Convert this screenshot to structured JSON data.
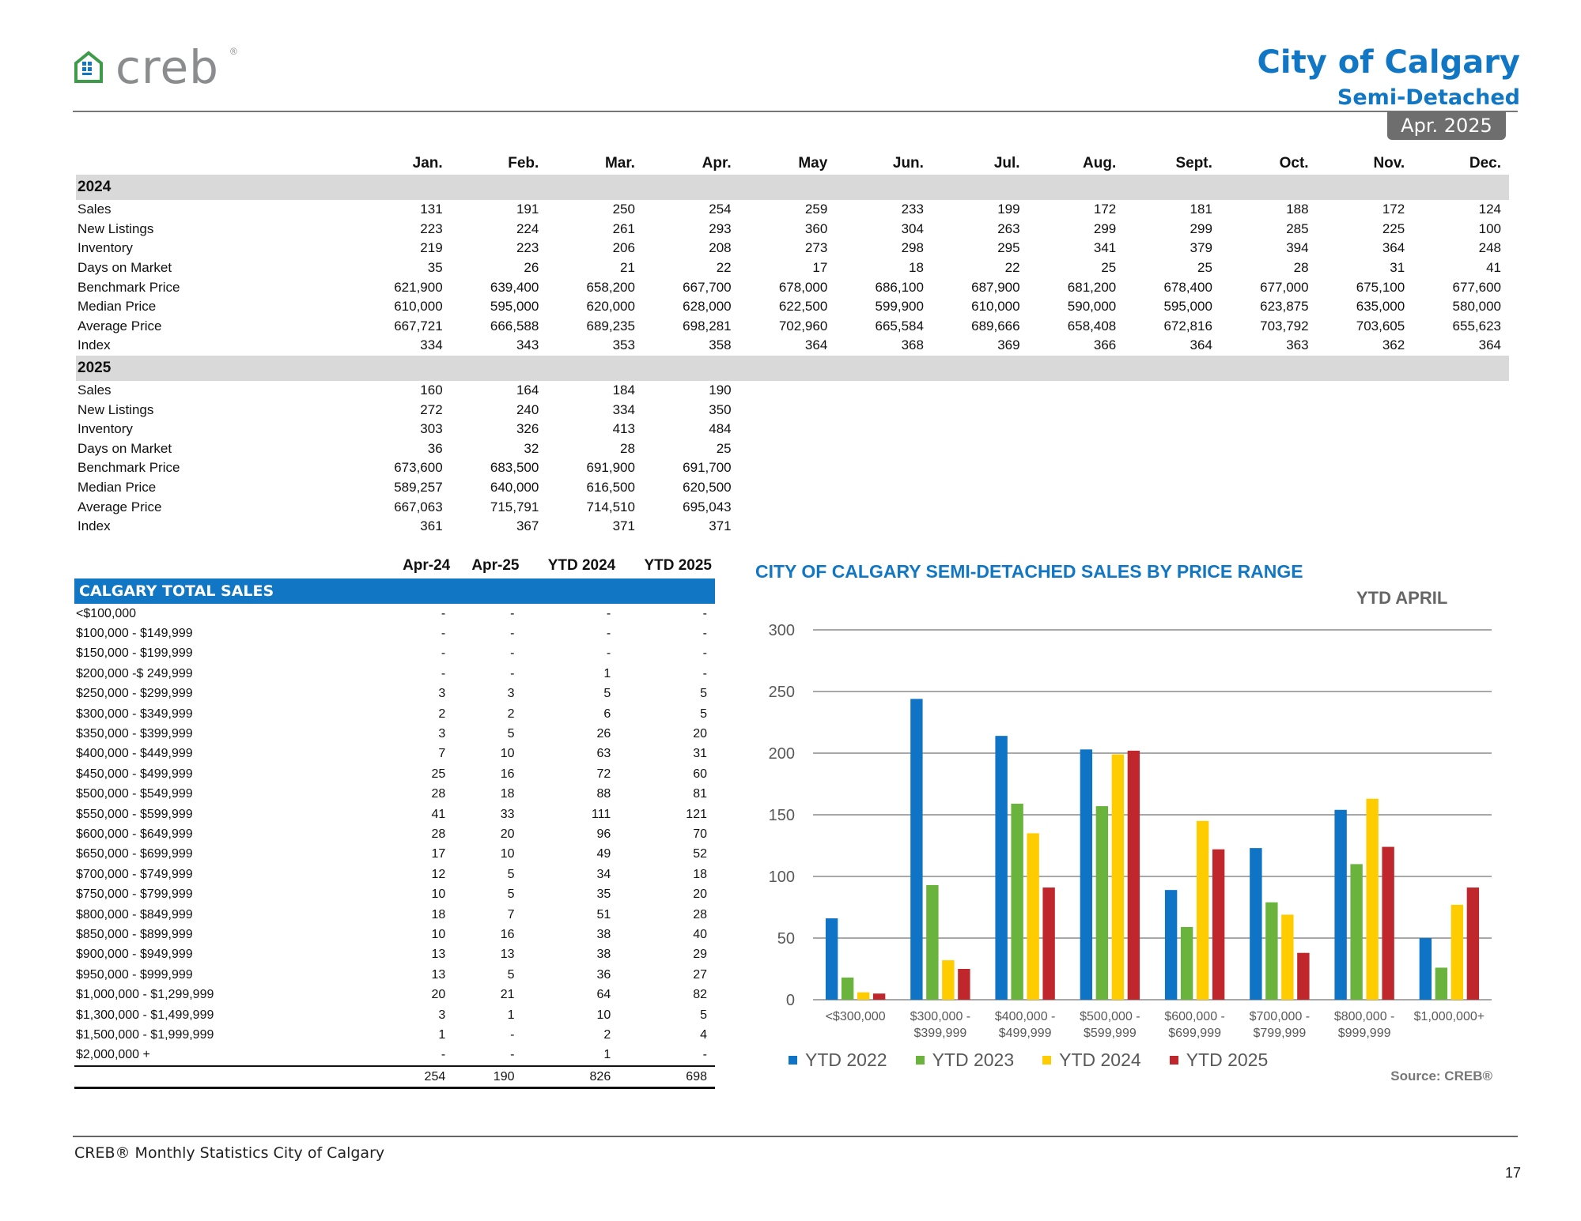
{
  "header": {
    "logo_text": "creb",
    "logo_reg": "®",
    "city": "City of Calgary",
    "property_type": "Semi-Detached",
    "period": "Apr. 2025"
  },
  "monthly": {
    "months": [
      "Jan.",
      "Feb.",
      "Mar.",
      "Apr.",
      "May",
      "Jun.",
      "Jul.",
      "Aug.",
      "Sept.",
      "Oct.",
      "Nov.",
      "Dec."
    ],
    "years": [
      {
        "year": "2024",
        "rows": [
          {
            "label": "Sales",
            "values": [
              "131",
              "191",
              "250",
              "254",
              "259",
              "233",
              "199",
              "172",
              "181",
              "188",
              "172",
              "124"
            ]
          },
          {
            "label": "New Listings",
            "values": [
              "223",
              "224",
              "261",
              "293",
              "360",
              "304",
              "263",
              "299",
              "299",
              "285",
              "225",
              "100"
            ]
          },
          {
            "label": "Inventory",
            "values": [
              "219",
              "223",
              "206",
              "208",
              "273",
              "298",
              "295",
              "341",
              "379",
              "394",
              "364",
              "248"
            ]
          },
          {
            "label": "Days on Market",
            "values": [
              "35",
              "26",
              "21",
              "22",
              "17",
              "18",
              "22",
              "25",
              "25",
              "28",
              "31",
              "41"
            ]
          },
          {
            "label": "Benchmark Price",
            "values": [
              "621,900",
              "639,400",
              "658,200",
              "667,700",
              "678,000",
              "686,100",
              "687,900",
              "681,200",
              "678,400",
              "677,000",
              "675,100",
              "677,600"
            ]
          },
          {
            "label": "Median Price",
            "values": [
              "610,000",
              "595,000",
              "620,000",
              "628,000",
              "622,500",
              "599,900",
              "610,000",
              "590,000",
              "595,000",
              "623,875",
              "635,000",
              "580,000"
            ]
          },
          {
            "label": "Average Price",
            "values": [
              "667,721",
              "666,588",
              "689,235",
              "698,281",
              "702,960",
              "665,584",
              "689,666",
              "658,408",
              "672,816",
              "703,792",
              "703,605",
              "655,623"
            ]
          },
          {
            "label": "Index",
            "values": [
              "334",
              "343",
              "353",
              "358",
              "364",
              "368",
              "369",
              "366",
              "364",
              "363",
              "362",
              "364"
            ]
          }
        ]
      },
      {
        "year": "2025",
        "rows": [
          {
            "label": "Sales",
            "values": [
              "160",
              "164",
              "184",
              "190",
              "",
              "",
              "",
              "",
              "",
              "",
              "",
              ""
            ]
          },
          {
            "label": "New Listings",
            "values": [
              "272",
              "240",
              "334",
              "350",
              "",
              "",
              "",
              "",
              "",
              "",
              "",
              ""
            ]
          },
          {
            "label": "Inventory",
            "values": [
              "303",
              "326",
              "413",
              "484",
              "",
              "",
              "",
              "",
              "",
              "",
              "",
              ""
            ]
          },
          {
            "label": "Days on Market",
            "values": [
              "36",
              "32",
              "28",
              "25",
              "",
              "",
              "",
              "",
              "",
              "",
              "",
              ""
            ]
          },
          {
            "label": "Benchmark Price",
            "values": [
              "673,600",
              "683,500",
              "691,900",
              "691,700",
              "",
              "",
              "",
              "",
              "",
              "",
              "",
              ""
            ]
          },
          {
            "label": "Median Price",
            "values": [
              "589,257",
              "640,000",
              "616,500",
              "620,500",
              "",
              "",
              "",
              "",
              "",
              "",
              "",
              ""
            ]
          },
          {
            "label": "Average Price",
            "values": [
              "667,063",
              "715,791",
              "714,510",
              "695,043",
              "",
              "",
              "",
              "",
              "",
              "",
              "",
              ""
            ]
          },
          {
            "label": "Index",
            "values": [
              "361",
              "367",
              "371",
              "371",
              "",
              "",
              "",
              "",
              "",
              "",
              "",
              ""
            ]
          }
        ]
      }
    ]
  },
  "price_table": {
    "headers": [
      "Apr-24",
      "Apr-25",
      "YTD 2024",
      "YTD 2025"
    ],
    "section_title": "CALGARY TOTAL SALES",
    "rows": [
      {
        "label": "<$100,000",
        "values": [
          "-",
          "-",
          "-",
          "-"
        ]
      },
      {
        "label": "$100,000 - $149,999",
        "values": [
          "-",
          "-",
          "-",
          "-"
        ]
      },
      {
        "label": "$150,000 - $199,999",
        "values": [
          "-",
          "-",
          "-",
          "-"
        ]
      },
      {
        "label": "$200,000 -$ 249,999",
        "values": [
          "-",
          "-",
          "1",
          "-"
        ]
      },
      {
        "label": "$250,000 - $299,999",
        "values": [
          "3",
          "3",
          "5",
          "5"
        ]
      },
      {
        "label": "$300,000 - $349,999",
        "values": [
          "2",
          "2",
          "6",
          "5"
        ]
      },
      {
        "label": "$350,000 - $399,999",
        "values": [
          "3",
          "5",
          "26",
          "20"
        ]
      },
      {
        "label": "$400,000 - $449,999",
        "values": [
          "7",
          "10",
          "63",
          "31"
        ]
      },
      {
        "label": "$450,000 - $499,999",
        "values": [
          "25",
          "16",
          "72",
          "60"
        ]
      },
      {
        "label": "$500,000 - $549,999",
        "values": [
          "28",
          "18",
          "88",
          "81"
        ]
      },
      {
        "label": "$550,000 - $599,999",
        "values": [
          "41",
          "33",
          "111",
          "121"
        ]
      },
      {
        "label": "$600,000 - $649,999",
        "values": [
          "28",
          "20",
          "96",
          "70"
        ]
      },
      {
        "label": "$650,000 - $699,999",
        "values": [
          "17",
          "10",
          "49",
          "52"
        ]
      },
      {
        "label": "$700,000 - $749,999",
        "values": [
          "12",
          "5",
          "34",
          "18"
        ]
      },
      {
        "label": "$750,000 - $799,999",
        "values": [
          "10",
          "5",
          "35",
          "20"
        ]
      },
      {
        "label": "$800,000 - $849,999",
        "values": [
          "18",
          "7",
          "51",
          "28"
        ]
      },
      {
        "label": "$850,000 - $899,999",
        "values": [
          "10",
          "16",
          "38",
          "40"
        ]
      },
      {
        "label": "$900,000 - $949,999",
        "values": [
          "13",
          "13",
          "38",
          "29"
        ]
      },
      {
        "label": "$950,000 - $999,999",
        "values": [
          "13",
          "5",
          "36",
          "27"
        ]
      },
      {
        "label": "$1,000,000 - $1,299,999",
        "values": [
          "20",
          "21",
          "64",
          "82"
        ]
      },
      {
        "label": "$1,300,000 - $1,499,999",
        "values": [
          "3",
          "1",
          "10",
          "5"
        ]
      },
      {
        "label": "$1,500,000 - $1,999,999",
        "values": [
          "1",
          "-",
          "2",
          "4"
        ]
      },
      {
        "label": "$2,000,000 +",
        "values": [
          "-",
          "-",
          "1",
          "-"
        ]
      }
    ],
    "totals": [
      "254",
      "190",
      "826",
      "698"
    ]
  },
  "chart_data": {
    "type": "bar",
    "title": "CITY OF CALGARY SEMI-DETACHED SALES BY PRICE RANGE",
    "subtitle": "YTD  APRIL",
    "categories": [
      [
        "<$300,000"
      ],
      [
        "$300,000 -",
        "$399,999"
      ],
      [
        "$400,000 -",
        "$499,999"
      ],
      [
        "$500,000 -",
        "$599,999"
      ],
      [
        "$600,000 -",
        "$699,999"
      ],
      [
        "$700,000 -",
        "$799,999"
      ],
      [
        "$800,000 -",
        "$999,999"
      ],
      [
        "$1,000,000+"
      ]
    ],
    "series": [
      {
        "name": "YTD  2022",
        "color": "#0f73c6",
        "values": [
          66,
          244,
          214,
          203,
          89,
          123,
          154,
          50
        ]
      },
      {
        "name": "YTD  2023",
        "color": "#6ab43e",
        "values": [
          18,
          93,
          159,
          157,
          59,
          79,
          110,
          26
        ]
      },
      {
        "name": "YTD  2024",
        "color": "#ffcc00",
        "values": [
          6,
          32,
          135,
          199,
          145,
          69,
          163,
          77
        ]
      },
      {
        "name": "YTD  2025",
        "color": "#c0272d",
        "values": [
          5,
          25,
          91,
          202,
          122,
          38,
          124,
          91
        ]
      }
    ],
    "ylim": [
      0,
      300
    ],
    "yticks": [
      0,
      50,
      100,
      150,
      200,
      250,
      300
    ],
    "grid": true,
    "legend": "bottom",
    "source": "Source: CREB®"
  },
  "footer": {
    "text": "CREB® Monthly Statistics City of Calgary",
    "page": "17"
  }
}
